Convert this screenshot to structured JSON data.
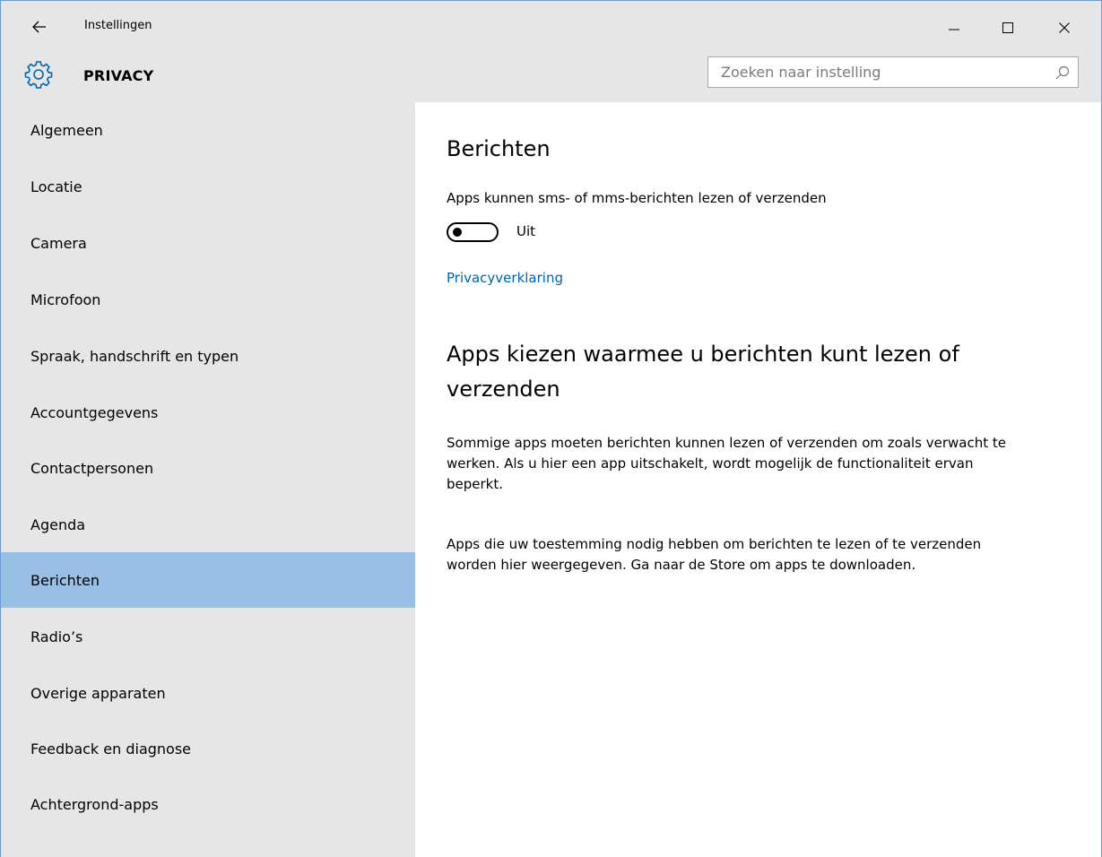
{
  "window": {
    "title": "Instellingen",
    "back_icon": "back-arrow-icon",
    "controls": [
      "minimize-icon",
      "maximize-icon",
      "close-icon"
    ]
  },
  "header": {
    "section_title": "PRIVACY",
    "icon": "gear-icon",
    "search_placeholder": "Zoeken naar instelling",
    "search_value": ""
  },
  "sidebar": {
    "items": [
      {
        "label": "Algemeen"
      },
      {
        "label": "Locatie"
      },
      {
        "label": "Camera"
      },
      {
        "label": "Microfoon"
      },
      {
        "label": "Spraak, handschrift en typen"
      },
      {
        "label": "Accountgegevens"
      },
      {
        "label": "Contactpersonen"
      },
      {
        "label": "Agenda"
      },
      {
        "label": "Berichten",
        "selected": true
      },
      {
        "label": "Radio’s"
      },
      {
        "label": "Overige apparaten"
      },
      {
        "label": "Feedback en diagnose"
      },
      {
        "label": "Achtergrond-apps"
      }
    ]
  },
  "main": {
    "heading": "Berichten",
    "setting_label": "Apps kunnen sms- of mms-berichten lezen of verzenden",
    "toggle_state": "Uit",
    "toggle_on": false,
    "privacy_link": "Privacyverklaring",
    "subheading": "Apps kiezen waarmee u berichten kunt lezen of verzenden",
    "paragraph1": "Sommige apps moeten berichten kunnen lezen of verzenden om zoals verwacht te werken. Als u hier een app uitschakelt, wordt mogelijk de functionaliteit ervan beperkt.",
    "paragraph2": "Apps die uw toestemming nodig hebben om berichten te lezen of te verzenden worden hier weergegeven. Ga naar de Store om apps te downloaden."
  },
  "colors": {
    "chrome_bg": "#e6e6e6",
    "selected_bg": "#98c0e6",
    "link": "#0063b1",
    "window_border": "#6c9ccf"
  }
}
